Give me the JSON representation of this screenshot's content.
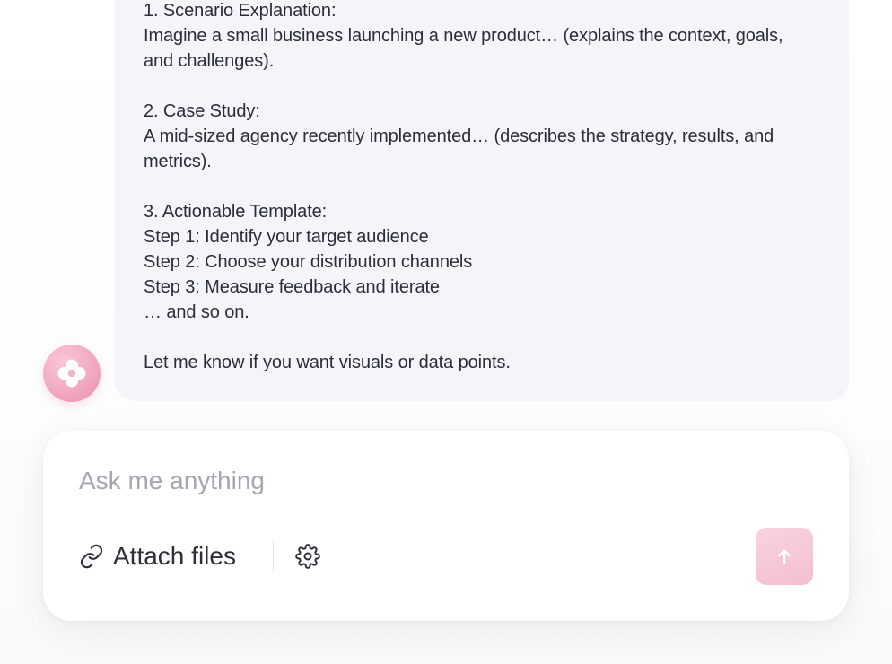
{
  "message": {
    "lines": [
      "1. Scenario Explanation:",
      "Imagine a small business launching a new product… (explains the context, goals,",
      "and challenges).",
      "",
      "2. Case Study:",
      "A mid-sized agency recently implemented… (describes the strategy, results, and",
      "metrics).",
      "",
      "3. Actionable Template:",
      "Step 1: Identify your target audience",
      "Step 2: Choose your distribution channels",
      "Step 3: Measure feedback and iterate",
      "… and so on.",
      "",
      "Let me know if you want visuals or data points."
    ]
  },
  "avatar": {
    "icon": "flower-logo-icon",
    "color": "#f2a9bf"
  },
  "composer": {
    "placeholder": "Ask me anything",
    "value": "",
    "attach_label": "Attach files",
    "attach_icon": "link-icon",
    "settings_icon": "gear-icon",
    "send_icon": "arrow-up-icon",
    "send_color": "#f6c6d5"
  },
  "colors": {
    "bubble_background": "#f3f5fa",
    "text": "#2a2e36",
    "placeholder": "#a3a7b0",
    "accent": "#f2a9bf"
  }
}
